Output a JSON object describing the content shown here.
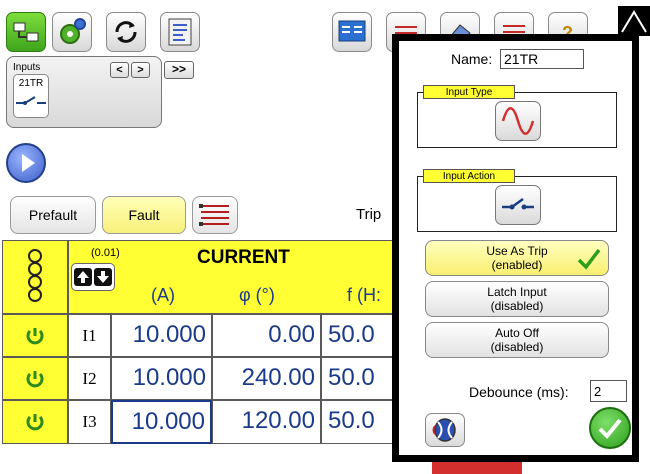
{
  "toolbar": {
    "left_icons": [
      "network-icon",
      "gear-icon",
      "refresh-icon",
      "report-icon"
    ],
    "right_icons": [
      "display-icon",
      "waveform-icon",
      "eraser-icon",
      "flags-icon",
      "help-icon"
    ]
  },
  "inputs_panel": {
    "title": "Inputs",
    "prev_label": "<",
    "next_label": ">",
    "expand_label": ">>",
    "input_tile_label": "21TR"
  },
  "tabs": {
    "prefault": "Prefault",
    "fault": "Fault",
    "trip_label": "Trip"
  },
  "table": {
    "step": "(0.01)",
    "title": "CURRENT",
    "col_amp": "(A)",
    "col_phase": "φ (°)",
    "col_freq": "f (H:",
    "rows": [
      {
        "phase": "I1",
        "amp": "10.000",
        "angle": "0.00",
        "freq": "50.0"
      },
      {
        "phase": "I2",
        "amp": "10.000",
        "angle": "240.00",
        "freq": "50.0"
      },
      {
        "phase": "I3",
        "amp": "10.000",
        "angle": "120.00",
        "freq": "50.0"
      }
    ]
  },
  "popup": {
    "name_label": "Name:",
    "name_value": "21TR",
    "input_type_title": "Input Type",
    "input_action_title": "Input Action",
    "use_as_trip": {
      "title": "Use As Trip",
      "state": "(enabled)"
    },
    "latch_input": {
      "title": "Latch Input",
      "state": "(disabled)"
    },
    "auto_off": {
      "title": "Auto Off",
      "state": "(disabled)"
    },
    "debounce_label": "Debounce (ms):",
    "debounce_value": "2"
  },
  "colors": {
    "accent_yellow": "#ffff33",
    "value_blue": "#1a3a8a",
    "check_green": "#2e9e1a",
    "play_blue": "#3b5fc8"
  }
}
